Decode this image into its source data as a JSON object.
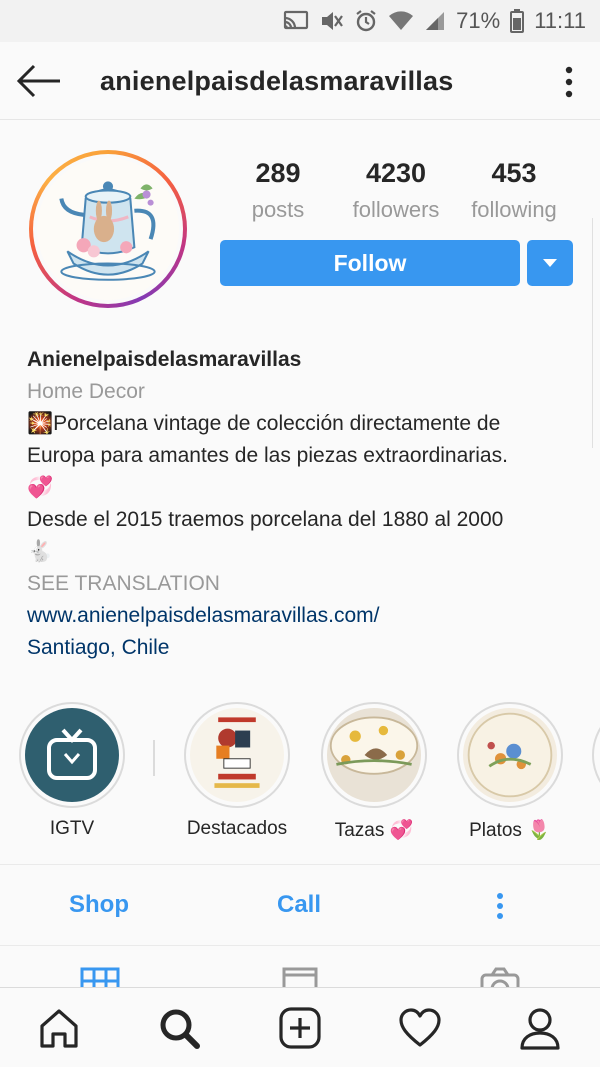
{
  "status_bar": {
    "battery": "71%",
    "time": "11:11",
    "icons": [
      "cast-icon",
      "mute-icon",
      "alarm-icon",
      "wifi-icon",
      "signal-icon",
      "battery-icon"
    ]
  },
  "header": {
    "username": "anienelpaisdelasmaravillas",
    "back_icon": "back-arrow-icon",
    "more_icon": "more-vertical-icon"
  },
  "profile": {
    "stats": [
      {
        "value": "289",
        "label": "posts"
      },
      {
        "value": "4230",
        "label": "followers"
      },
      {
        "value": "453",
        "label": "following"
      }
    ],
    "follow_label": "Follow"
  },
  "bio": {
    "name": "Anienelpaisdelasmaravillas",
    "category": "Home Decor",
    "line1": "🎇Porcelana vintage de colección directamente de",
    "line2": "Europa para amantes de las piezas extraordinarias.",
    "emoji1": "💞",
    "line3": "Desde el 2015 traemos porcelana del 1880 al 2000",
    "emoji2": "🐇",
    "see_translation": "SEE TRANSLATION",
    "website": "www.anienelpaisdelasmaravillas.com/",
    "location": "Santiago, Chile"
  },
  "highlights": [
    {
      "label": "IGTV"
    },
    {
      "label": "Destacados"
    },
    {
      "label": "Tazas 💞"
    },
    {
      "label": "Platos 🌷"
    }
  ],
  "actions": {
    "shop": "Shop",
    "call": "Call"
  },
  "bottom_nav": [
    "home-icon",
    "search-icon",
    "new-post-icon",
    "activity-heart-icon",
    "profile-icon"
  ],
  "colors": {
    "accent": "#3897f0",
    "link": "#003569",
    "muted": "#999999"
  }
}
